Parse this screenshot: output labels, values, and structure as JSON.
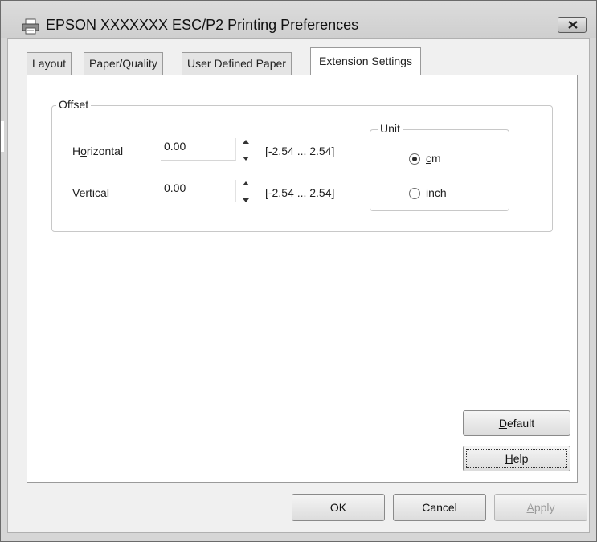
{
  "window": {
    "title": "EPSON XXXXXXX ESC/P2 Printing Preferences",
    "icon": "printer-icon",
    "close_icon": "close-icon"
  },
  "tabs": [
    {
      "label": "Layout",
      "active": false
    },
    {
      "label": "Paper/Quality",
      "active": false
    },
    {
      "label": "User Defined Paper",
      "active": false
    },
    {
      "label": "Extension Settings",
      "active": true
    }
  ],
  "offset": {
    "legend": "Offset",
    "horizontal": {
      "label_pre": "H",
      "label_acc": "o",
      "label_post": "rizontal",
      "value": "0.00",
      "range": "[-2.54 ... 2.54]"
    },
    "vertical": {
      "label_pre": "",
      "label_acc": "V",
      "label_post": "ertical",
      "value": "0.00",
      "range": "[-2.54 ... 2.54]"
    }
  },
  "unit": {
    "legend": "Unit",
    "options": [
      {
        "acc": "c",
        "rest": "m",
        "selected": true
      },
      {
        "acc": "i",
        "rest": "nch",
        "selected": false
      }
    ]
  },
  "buttons": {
    "default": {
      "acc": "D",
      "rest": "efault"
    },
    "help": {
      "acc": "H",
      "rest": "elp"
    },
    "ok": "OK",
    "cancel": "Cancel",
    "apply": {
      "acc": "A",
      "rest": "pply",
      "disabled": true
    }
  }
}
